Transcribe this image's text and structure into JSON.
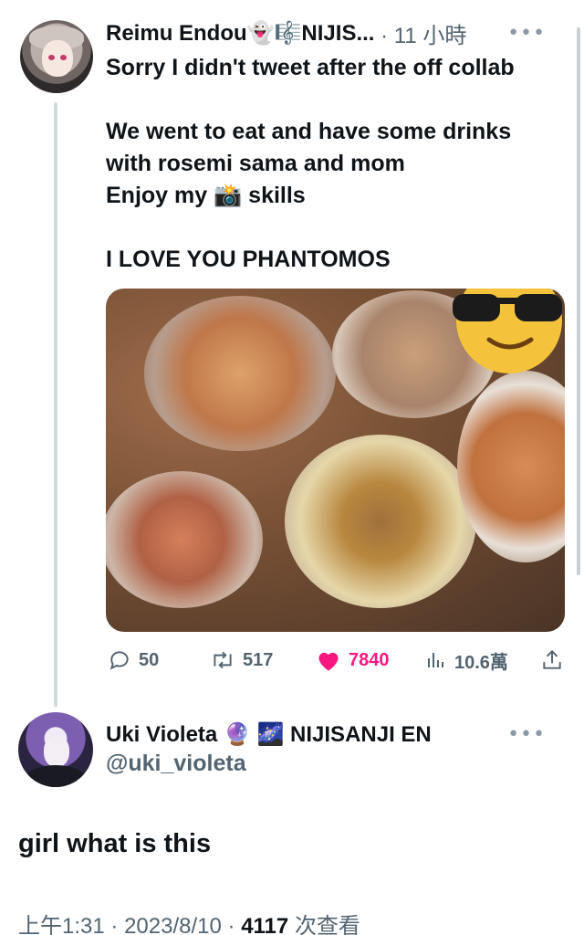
{
  "parent_tweet": {
    "author_name": "Reimu Endou👻🎼NIJIS...",
    "time": "11 小時",
    "text_lines": [
      "Sorry I didn't tweet after the off collab",
      "",
      "We went to eat and have some drinks",
      "with rosemi sama and mom",
      "Enjoy my 📸 skills",
      "",
      "I LOVE YOU PHANTOMOS"
    ],
    "actions": {
      "replies": "50",
      "reposts": "517",
      "likes": "7840",
      "views": "10.6萬"
    }
  },
  "main_tweet": {
    "author_name": "Uki Violeta 🔮 🌌 NIJISANJI EN",
    "handle": "@uki_violeta",
    "text": "girl what is this",
    "meta": {
      "time": "上午1:31",
      "date": "2023/8/10",
      "views": "4117",
      "views_label": "次查看"
    }
  },
  "colors": {
    "text": "#0f1419",
    "secondary": "#536471",
    "like": "#f91880",
    "thread_line": "#cfd9de"
  }
}
